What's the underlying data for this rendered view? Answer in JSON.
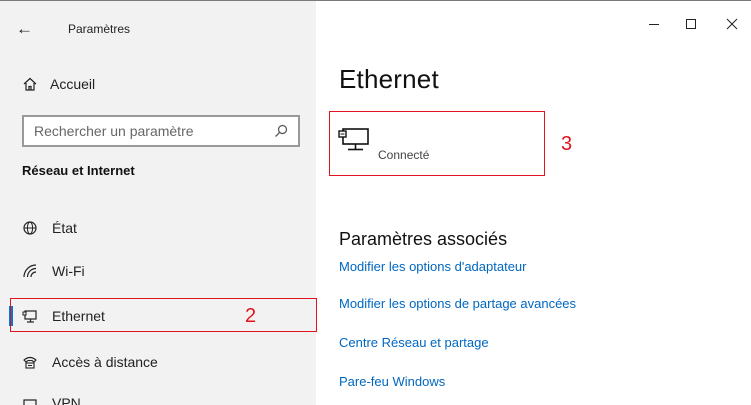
{
  "window": {
    "title": "Paramètres",
    "back_icon": "back-arrow-icon",
    "controls": [
      "minimize",
      "maximize",
      "close"
    ]
  },
  "sidebar": {
    "home_label": "Accueil",
    "search_placeholder": "Rechercher un paramètre",
    "section_title": "Réseau et Internet",
    "items": [
      {
        "label": "État",
        "icon": "globe-icon",
        "selected": false
      },
      {
        "label": "Wi-Fi",
        "icon": "wifi-icon",
        "selected": false
      },
      {
        "label": "Ethernet",
        "icon": "ethernet-icon",
        "selected": true
      },
      {
        "label": "Accès à distance",
        "icon": "dialup-icon",
        "selected": false
      },
      {
        "label": "VPN",
        "icon": "vpn-icon",
        "selected": false
      }
    ]
  },
  "main": {
    "heading": "Ethernet",
    "connection_status": "Connecté",
    "related_heading": "Paramètres associés",
    "links": [
      "Modifier les options d'adaptateur",
      "Modifier les options de partage avancées",
      "Centre Réseau et partage",
      "Pare-feu Windows"
    ]
  },
  "annotations": {
    "sidebar_marker": "2",
    "connection_marker": "3"
  },
  "colors": {
    "accent": "#0078d7",
    "link": "#0067c0",
    "annotation": "#e0141e",
    "sidebar_bg": "#f2f2f2"
  }
}
